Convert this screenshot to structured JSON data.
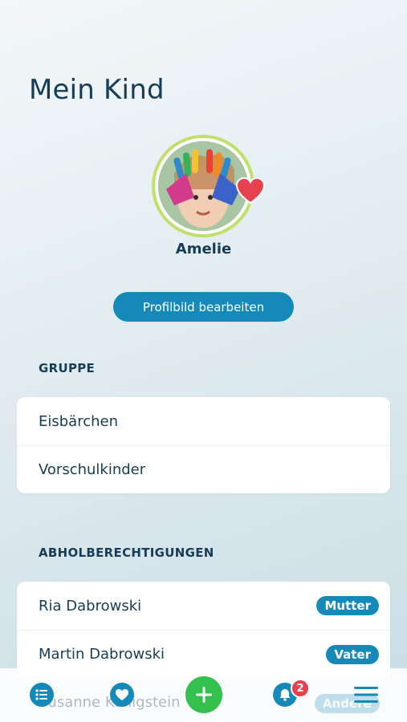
{
  "header": {
    "title": "Mein Kind"
  },
  "child": {
    "name": "Amelie"
  },
  "actions": {
    "edit_profile_picture": "Profilbild bearbeiten"
  },
  "group_section": {
    "heading": "GRUPPE",
    "items": [
      {
        "label": "Eisbärchen"
      },
      {
        "label": "Vorschulkinder"
      }
    ]
  },
  "pickup_section": {
    "heading": "ABHOLBERECHTIGUNGEN",
    "items": [
      {
        "name": "Ria Dabrowski",
        "role": "Mutter"
      },
      {
        "name": "Martin Dabrowski",
        "role": "Vater"
      },
      {
        "name": "Susanne Königstein",
        "role": "Andere"
      }
    ]
  },
  "bottom_nav": {
    "items": [
      {
        "icon": "list-icon"
      },
      {
        "icon": "heart-icon"
      },
      {
        "icon": "plus-icon"
      },
      {
        "icon": "bell-icon",
        "badge": "2"
      },
      {
        "icon": "hamburger-menu-icon"
      }
    ]
  },
  "colors": {
    "primary": "#1589b8",
    "accent_green": "#33c04d",
    "ring": "#bfe06a",
    "notification": "#e5424f",
    "heart": "#e5424f"
  }
}
